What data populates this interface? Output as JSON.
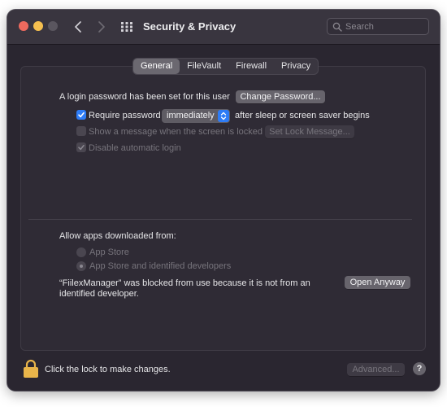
{
  "window": {
    "title": "Security & Privacy",
    "search_placeholder": "Search"
  },
  "tabs": [
    {
      "label": "General",
      "active": true
    },
    {
      "label": "FileVault",
      "active": false
    },
    {
      "label": "Firewall",
      "active": false
    },
    {
      "label": "Privacy",
      "active": false
    }
  ],
  "general": {
    "login_password_text": "A login password has been set for this user",
    "change_password_label": "Change Password...",
    "require_password_label": "Require password",
    "require_password_checked": true,
    "require_password_delay": "immediately",
    "after_sleep_text": "after sleep or screen saver begins",
    "show_message_label": "Show a message when the screen is locked",
    "show_message_checked": false,
    "set_lock_message_label": "Set Lock Message...",
    "disable_auto_login_label": "Disable automatic login",
    "disable_auto_login_checked": true
  },
  "allow_apps": {
    "heading": "Allow apps downloaded from:",
    "options": [
      {
        "label": "App Store",
        "selected": false
      },
      {
        "label": "App Store and identified developers",
        "selected": true
      }
    ],
    "blocked_message_line1": "“FiilexManager” was blocked from use because it is not from an",
    "blocked_message_line2": "identified developer.",
    "open_anyway_label": "Open Anyway"
  },
  "footer": {
    "lock_text": "Click the lock to make changes.",
    "advanced_label": "Advanced...",
    "help_label": "?"
  },
  "colors": {
    "accent": "#2e7cf6",
    "lock": "#e9b54a",
    "close": "#ed6a5e",
    "minimize": "#f5bf4f"
  }
}
